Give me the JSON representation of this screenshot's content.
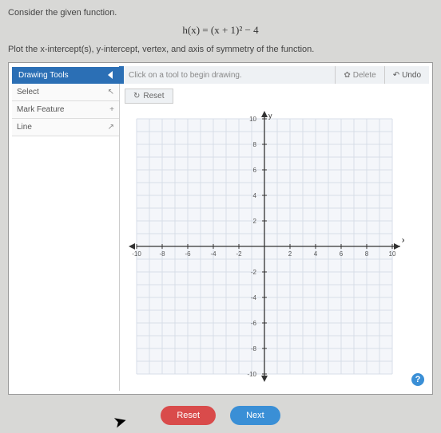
{
  "question": "Consider the given function.",
  "formula": "h(x) = (x + 1)² − 4",
  "instruction": "Plot the x-intercept(s), y-intercept, vertex, and axis of symmetry of the function.",
  "toolbar": {
    "header": "Drawing Tools",
    "hint": "Click on a tool to begin drawing.",
    "delete": "Delete",
    "undo": "Undo"
  },
  "sidebar": {
    "items": [
      {
        "label": "Select",
        "icon": "↖"
      },
      {
        "label": "Mark Feature",
        "icon": "+"
      },
      {
        "label": "Line",
        "icon": "↗"
      }
    ]
  },
  "graph": {
    "reset": "Reset"
  },
  "actions": {
    "reset": "Reset",
    "next": "Next"
  },
  "help": "?",
  "chart_data": {
    "type": "scatter",
    "title": "",
    "xlabel": "x",
    "ylabel": "y",
    "xlim": [
      -10,
      10
    ],
    "ylim": [
      -10,
      10
    ],
    "xticks": [
      -10,
      -8,
      -6,
      -4,
      -2,
      2,
      4,
      6,
      8,
      10
    ],
    "yticks": [
      -10,
      -8,
      -6,
      -4,
      -2,
      2,
      4,
      6,
      8,
      10
    ],
    "series": [],
    "grid": true
  }
}
